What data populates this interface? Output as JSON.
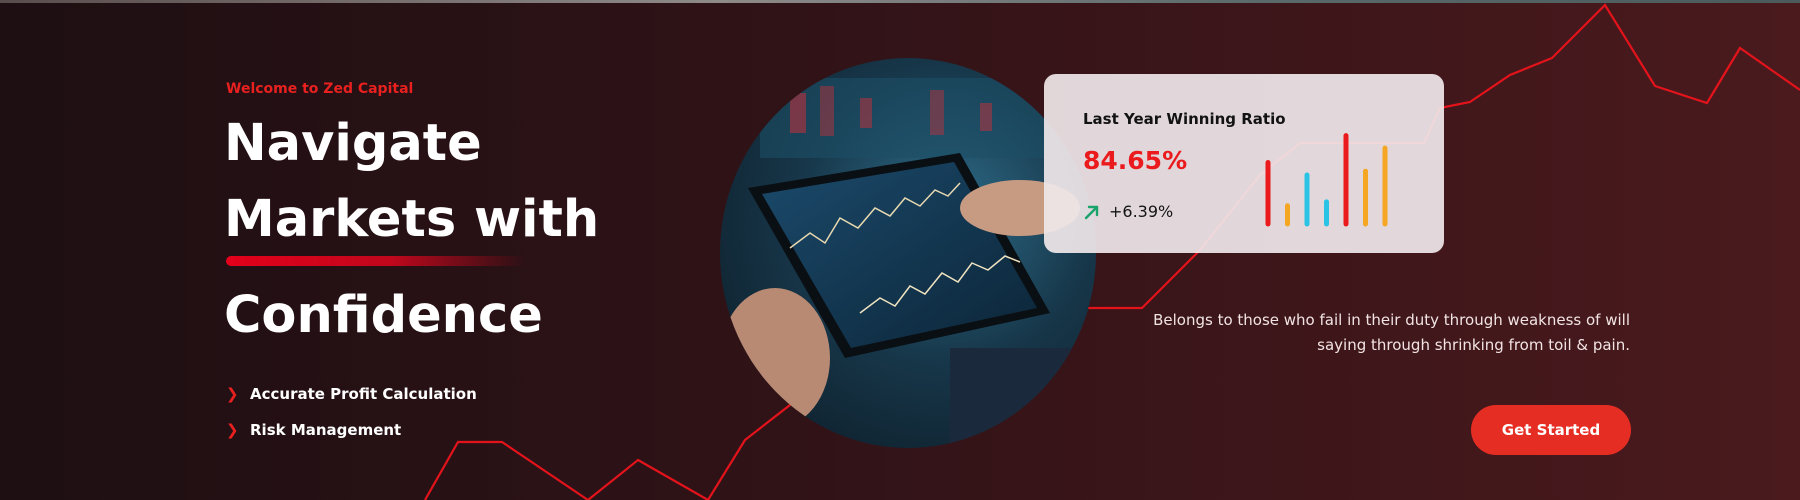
{
  "hero": {
    "eyebrow": "Welcome to Zed Capital",
    "headline": {
      "line1": "Navigate",
      "line2": "Markets with",
      "line3": "Confidence"
    },
    "features": [
      {
        "icon": "chevron-right-icon",
        "label": "Accurate Profit Calculation"
      },
      {
        "icon": "chevron-right-icon",
        "label": "Risk Management"
      }
    ],
    "image": {
      "subject": "hands-holding-tablet-with-stock-charts"
    }
  },
  "stats_card": {
    "title": "Last Year Winning Ratio",
    "value": "84.65%",
    "change": "+6.39%",
    "change_icon": "arrow-up-right-icon",
    "mini_chart_bars": [
      {
        "value": 0.64,
        "color": "#ea1a1d"
      },
      {
        "value": 0.19,
        "color": "#f5a623"
      },
      {
        "value": 0.51,
        "color": "#29c3e6"
      },
      {
        "value": 0.23,
        "color": "#29c3e6"
      },
      {
        "value": 0.92,
        "color": "#ea1a1d"
      },
      {
        "value": 0.55,
        "color": "#f5a623"
      },
      {
        "value": 0.79,
        "color": "#f5a623"
      }
    ]
  },
  "tagline": "Belongs to those who fail in their duty through weakness of will saying through shrinking from toil & pain.",
  "cta": {
    "label": "Get Started"
  },
  "colors": {
    "accent": "#e8201f",
    "cta_background": "#e62d24",
    "background_dark": "#1d0f12",
    "background_light": "#4a1a1d",
    "positive": "#1aa36b"
  }
}
